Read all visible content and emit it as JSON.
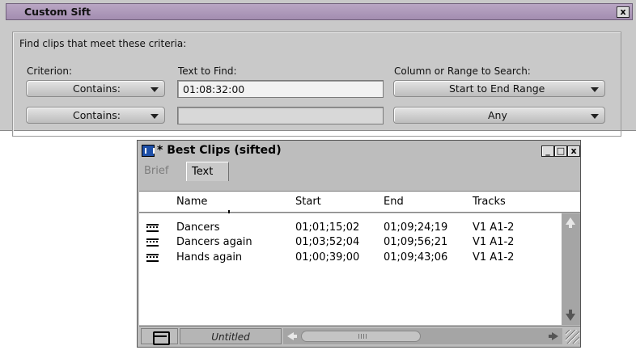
{
  "sift": {
    "title": "Custom Sift",
    "close_label": "x",
    "instructions": "Find clips that meet these criteria:",
    "criterion_label": "Criterion:",
    "text_to_find_label": "Text to Find:",
    "column_label": "Column or Range to Search:",
    "rows": [
      {
        "criterion": "Contains:",
        "text": "01:08:32:00",
        "column": "Start to End Range"
      },
      {
        "criterion": "Contains:",
        "text": "",
        "column": "Any"
      }
    ]
  },
  "bin": {
    "title": "* Best Clips (sifted)",
    "tabs": [
      "Brief",
      "Text"
    ],
    "columns": [
      "Name",
      "Start",
      "End",
      "Tracks"
    ],
    "clips": [
      {
        "name": "Dancers",
        "start": "01;01;15;02",
        "end": "01;09;24;19",
        "tracks": "V1 A1-2"
      },
      {
        "name": "Dancers again",
        "start": "01;03;52;04",
        "end": "01;09;56;21",
        "tracks": "V1 A1-2"
      },
      {
        "name": "Hands again",
        "start": "01;00;39;00",
        "end": "01;09;43;06",
        "tracks": "V1 A1-2"
      }
    ],
    "view_name": "Untitled",
    "icons": {
      "bin": "bin-icon",
      "clip": "clip-icon",
      "view": "view-toggle-icon"
    }
  },
  "colors": {
    "sift_titlebar": "#a38db0",
    "background": "#c9c9c9",
    "bin_icon": "#1d4fa8"
  }
}
